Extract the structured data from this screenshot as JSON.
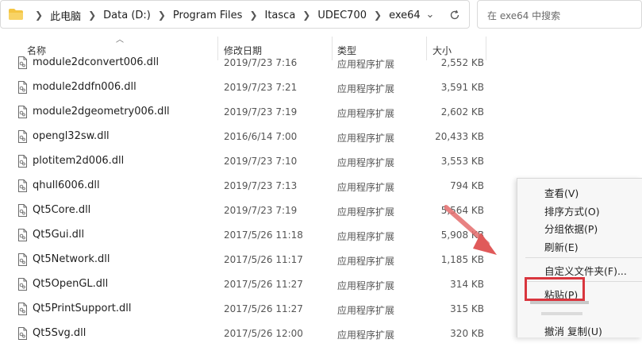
{
  "address_bar": {
    "crumbs": [
      "此电脑",
      "Data (D:)",
      "Program Files",
      "Itasca",
      "UDEC700",
      "exe64"
    ]
  },
  "search": {
    "placeholder": "在 exe64 中搜索"
  },
  "columns": {
    "name": "名称",
    "date": "修改日期",
    "type": "类型",
    "size": "大小"
  },
  "files": [
    {
      "name": "module2dconvert006.dll",
      "date": "2019/7/23 7:16",
      "type": "应用程序扩展",
      "size": "2,552 KB"
    },
    {
      "name": "module2ddfn006.dll",
      "date": "2019/7/23 7:21",
      "type": "应用程序扩展",
      "size": "3,591 KB"
    },
    {
      "name": "module2dgeometry006.dll",
      "date": "2019/7/23 7:19",
      "type": "应用程序扩展",
      "size": "2,602 KB"
    },
    {
      "name": "opengl32sw.dll",
      "date": "2016/6/14 7:00",
      "type": "应用程序扩展",
      "size": "20,433 KB"
    },
    {
      "name": "plotitem2d006.dll",
      "date": "2019/7/23 7:10",
      "type": "应用程序扩展",
      "size": "3,553 KB"
    },
    {
      "name": "qhull6006.dll",
      "date": "2019/7/23 7:13",
      "type": "应用程序扩展",
      "size": "794 KB"
    },
    {
      "name": "Qt5Core.dll",
      "date": "2019/7/23 7:19",
      "type": "应用程序扩展",
      "size": "5,564 KB"
    },
    {
      "name": "Qt5Gui.dll",
      "date": "2017/5/26 11:18",
      "type": "应用程序扩展",
      "size": "5,908 KB"
    },
    {
      "name": "Qt5Network.dll",
      "date": "2017/5/26 11:17",
      "type": "应用程序扩展",
      "size": "1,185 KB"
    },
    {
      "name": "Qt5OpenGL.dll",
      "date": "2017/5/26 11:27",
      "type": "应用程序扩展",
      "size": "314 KB"
    },
    {
      "name": "Qt5PrintSupport.dll",
      "date": "2017/5/26 11:27",
      "type": "应用程序扩展",
      "size": "315 KB"
    },
    {
      "name": "Qt5Svg.dll",
      "date": "2017/5/26 12:00",
      "type": "应用程序扩展",
      "size": "320 KB"
    }
  ],
  "context_menu": {
    "view": "查看(V)",
    "sort": "排序方式(O)",
    "group": "分组依据(P)",
    "refresh": "刷新(E)",
    "customize": "自定义文件夹(F)...",
    "paste": "粘贴(P)",
    "undo": "撤消 复制(U)"
  },
  "colors": {
    "highlight": "#d9363e",
    "arrow": "#e05a5a"
  }
}
